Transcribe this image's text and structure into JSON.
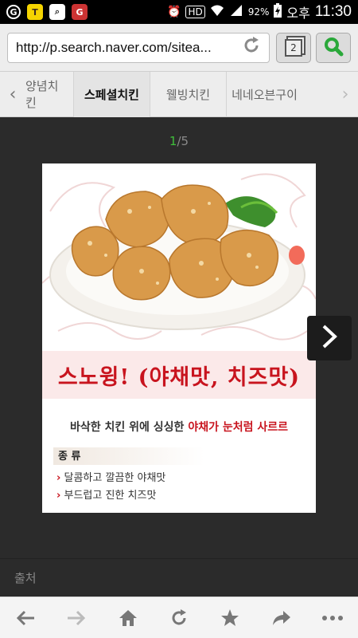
{
  "status": {
    "battery": "92%",
    "ampm": "오후",
    "time": "11:30",
    "hd": "HD"
  },
  "browser": {
    "url": "http://p.search.naver.com/sitea...",
    "tab_count": "2"
  },
  "categories": {
    "items": [
      "양념치킨",
      "스페셜치킨",
      "웰빙치킨",
      "네네오븐구이"
    ],
    "active": "스페셜치킨"
  },
  "pager": {
    "current": "1",
    "separator": "/",
    "total": "5"
  },
  "image": {
    "headline": "스노윙! (야채맛, 치즈맛)",
    "tagline_prefix": "바삭한 치킨 위에 싱싱한 ",
    "tagline_highlight": "야채가 눈처럼 사르르",
    "section_label": "종 류",
    "flavors": [
      "달콤하고 깔끔한 야채맛",
      "부드럽고 진한 치즈맛"
    ]
  },
  "source": {
    "label": "출처"
  },
  "toolbar": {
    "buttons": [
      "back-icon",
      "forward-icon",
      "home-icon",
      "reload-icon",
      "bookmark-icon",
      "share-icon",
      "more-icon"
    ]
  },
  "colors": {
    "accent_green": "#3fbf3a",
    "search_green": "#2aa83a",
    "headline_red": "#c8141e"
  }
}
